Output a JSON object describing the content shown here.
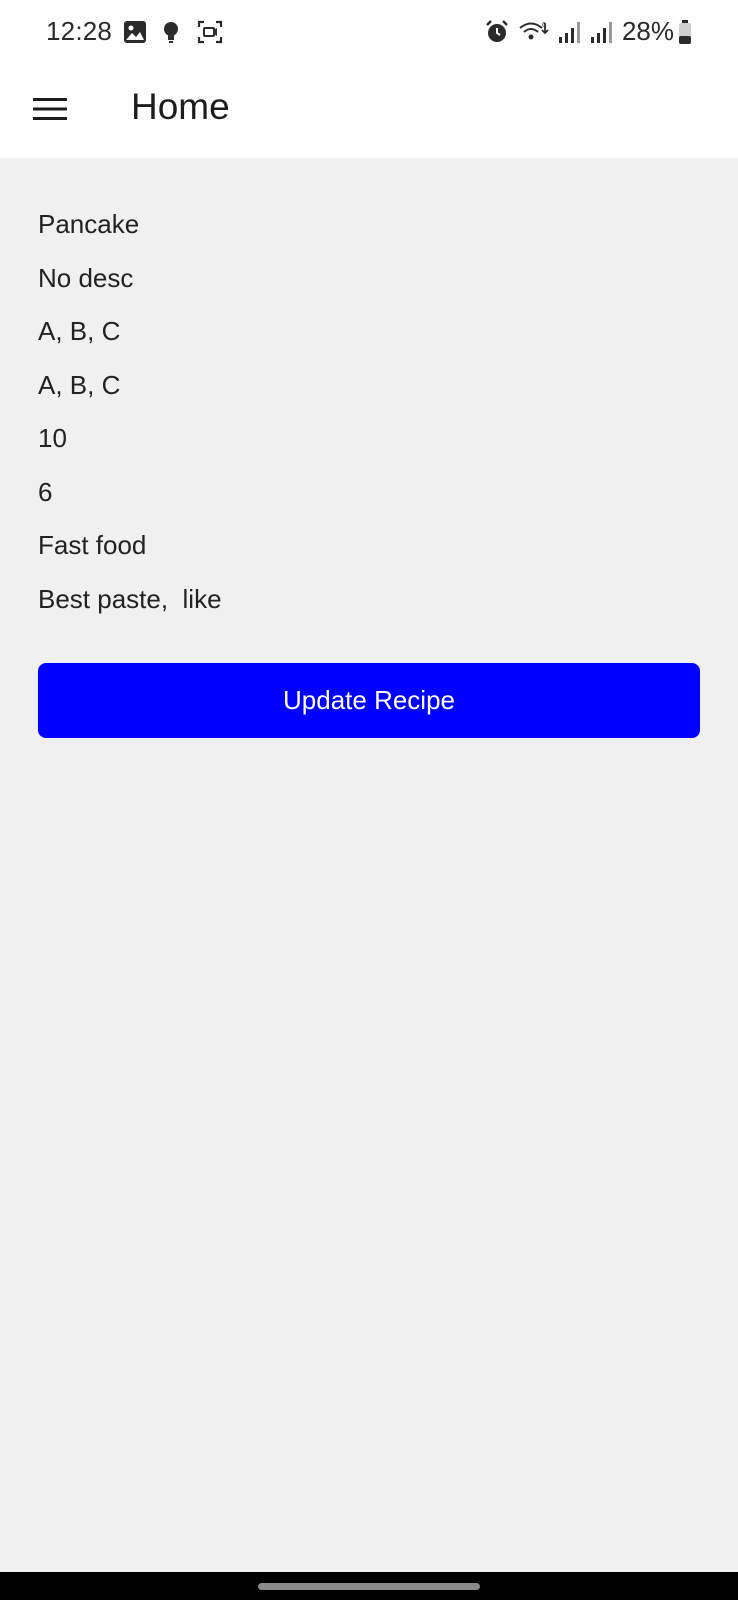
{
  "status_bar": {
    "time": "12:28",
    "battery": "28%",
    "left_icons": [
      "image-icon",
      "bulb-icon",
      "screen-record-icon"
    ],
    "right_icons": [
      "alarm-icon",
      "wifi-icon",
      "signal-icon",
      "signal-icon",
      "battery-icon"
    ]
  },
  "app_bar": {
    "title": "Home",
    "menu_icon": "hamburger-menu-icon"
  },
  "recipe": {
    "name": "Pancake",
    "description": "No desc",
    "ingredients": "A, B, C",
    "steps": "A, B, C",
    "time": "10",
    "servings": "6",
    "category": "Fast food",
    "notes": "Best paste,  like"
  },
  "actions": {
    "update_label": "Update Recipe"
  },
  "colors": {
    "button": "#0000ff",
    "background": "#f0f0f0",
    "app_bar": "#ffffff"
  }
}
